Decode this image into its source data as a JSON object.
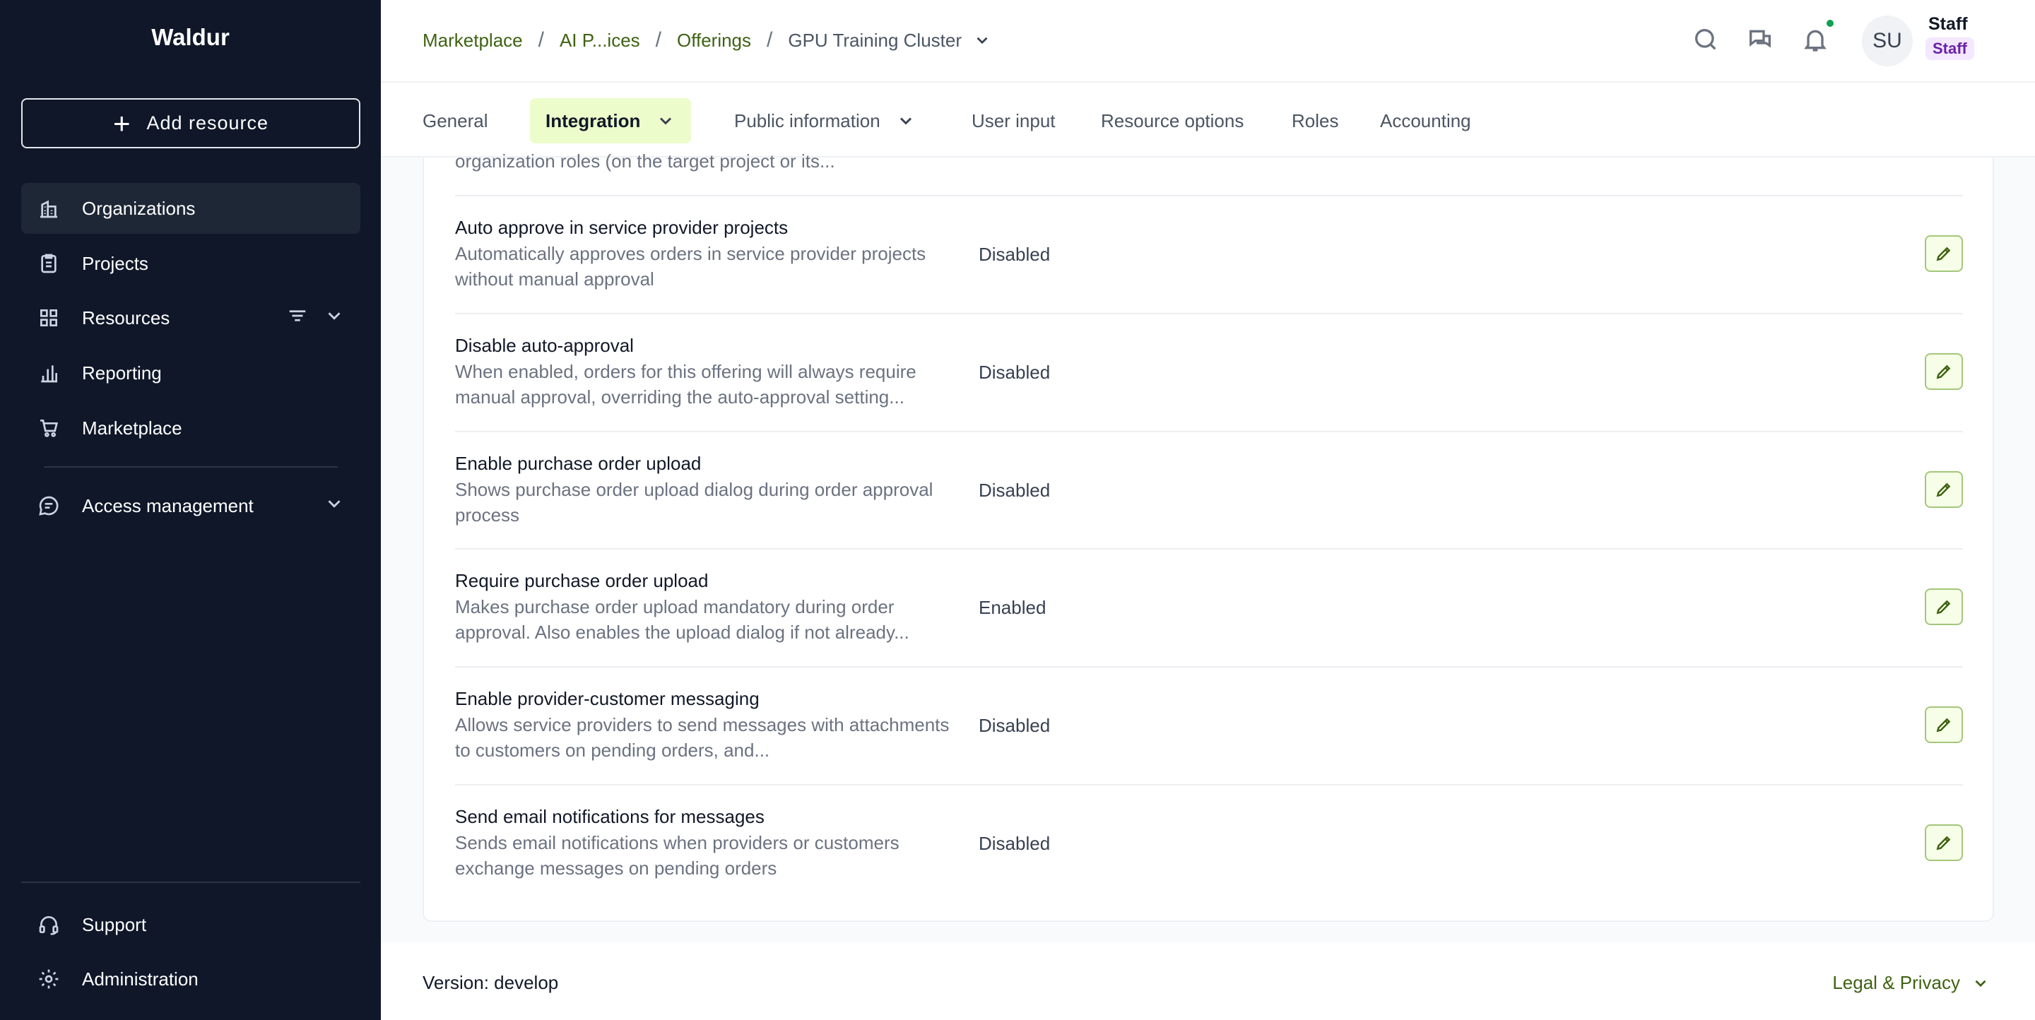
{
  "app": {
    "brand": "Waldur"
  },
  "sidebar": {
    "add_resource_label": "Add resource",
    "items": [
      {
        "label": "Organizations",
        "icon": "building-icon",
        "active": true
      },
      {
        "label": "Projects",
        "icon": "clipboard-icon"
      },
      {
        "label": "Resources",
        "icon": "grid-icon"
      },
      {
        "label": "Reporting",
        "icon": "bar-chart-icon"
      },
      {
        "label": "Marketplace",
        "icon": "cart-icon"
      },
      {
        "label": "Access management",
        "icon": "chat-icon"
      }
    ],
    "bottom_items": [
      {
        "label": "Support",
        "icon": "headset-icon"
      },
      {
        "label": "Administration",
        "icon": "gear-icon"
      }
    ]
  },
  "header": {
    "breadcrumbs": [
      "Marketplace",
      "AI P...ices",
      "Offerings"
    ],
    "current": "GPU Training Cluster",
    "user": {
      "initials": "SU",
      "name": "Staff",
      "badge": "Staff"
    }
  },
  "tabs": [
    {
      "label": "General"
    },
    {
      "label": "Integration",
      "active": true
    },
    {
      "label": "Public information"
    },
    {
      "label": "User input"
    },
    {
      "label": "Resource options"
    },
    {
      "label": "Roles"
    },
    {
      "label": "Accounting"
    }
  ],
  "content": {
    "clipped_text": "organization roles (on the target project or its...",
    "rows": [
      {
        "title": "Auto approve in service provider projects",
        "desc": "Automatically approves orders in service provider projects without manual approval",
        "value": "Disabled"
      },
      {
        "title": "Disable auto-approval",
        "desc": "When enabled, orders for this offering will always require manual approval, overriding the auto-approval setting...",
        "value": "Disabled"
      },
      {
        "title": "Enable purchase order upload",
        "desc": "Shows purchase order upload dialog during order approval process",
        "value": "Disabled"
      },
      {
        "title": "Require purchase order upload",
        "desc": "Makes purchase order upload mandatory during order approval. Also enables the upload dialog if not already...",
        "value": "Enabled"
      },
      {
        "title": "Enable provider-customer messaging",
        "desc": "Allows service providers to send messages with attachments to customers on pending orders, and...",
        "value": "Disabled"
      },
      {
        "title": "Send email notifications for messages",
        "desc": "Sends email notifications when providers or customers exchange messages on pending orders",
        "value": "Disabled"
      }
    ]
  },
  "footer": {
    "version": "Version: develop",
    "legal": "Legal & Privacy"
  }
}
